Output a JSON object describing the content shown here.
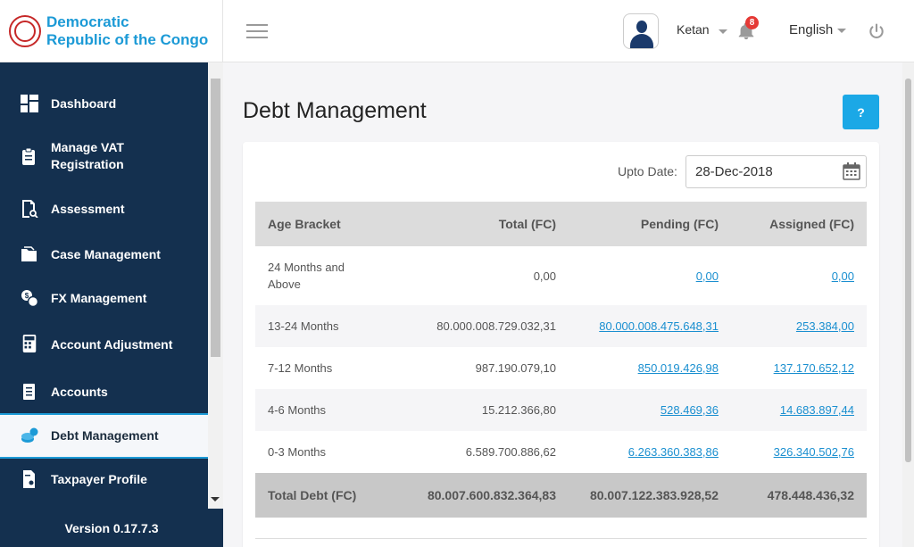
{
  "brand": {
    "line1": "Democratic",
    "line2": "Republic of the Congo",
    "color": "#1c9ad6"
  },
  "header": {
    "user_name": "Ketan",
    "notification_count": "8",
    "language": "English",
    "icons": {
      "menu": "hamburger-icon",
      "bell": "bell-icon",
      "power": "power-icon"
    }
  },
  "sidebar": {
    "items": [
      {
        "label": "Dashboard",
        "icon": "dashboard-icon"
      },
      {
        "label": "Manage VAT Registration",
        "icon": "clipboard-icon"
      },
      {
        "label": "Assessment",
        "icon": "document-search-icon"
      },
      {
        "label": "Case Management",
        "icon": "folder-icon"
      },
      {
        "label": "FX Management",
        "icon": "currency-exchange-icon"
      },
      {
        "label": "Account Adjustment",
        "icon": "calculator-icon"
      },
      {
        "label": "Accounts",
        "icon": "ledger-icon"
      },
      {
        "label": "Debt Management",
        "icon": "coins-icon",
        "active": true
      },
      {
        "label": "Taxpayer Profile",
        "icon": "profile-document-icon"
      }
    ],
    "version": "Version 0.17.7.3"
  },
  "page": {
    "title": "Debt Management",
    "help_label": "?",
    "upto_label": "Upto Date:",
    "upto_value": "28-Dec-2018"
  },
  "table": {
    "headers": [
      "Age Bracket",
      "Total (FC)",
      "Pending (FC)",
      "Assigned (FC)"
    ],
    "rows": [
      {
        "bracket": "24 Months and Above",
        "total": "0,00",
        "pending": "0,00",
        "assigned": "0,00"
      },
      {
        "bracket": "13-24 Months",
        "total": "80.000.008.729.032,31",
        "pending": "80.000.008.475.648,31",
        "assigned": "253.384,00"
      },
      {
        "bracket": "7-12 Months",
        "total": "987.190.079,10",
        "pending": "850.019.426,98",
        "assigned": "137.170.652,12"
      },
      {
        "bracket": "4-6 Months",
        "total": "15.212.366,80",
        "pending": "528.469,36",
        "assigned": "14.683.897,44"
      },
      {
        "bracket": "0-3 Months",
        "total": "6.589.700.886,62",
        "pending": "6.263.360.383,86",
        "assigned": "326.340.502,76"
      }
    ],
    "footer": {
      "label": "Total Debt (FC)",
      "total": "80.007.600.832.364,83",
      "pending": "80.007.122.383.928,52",
      "assigned": "478.448.436,32"
    }
  }
}
